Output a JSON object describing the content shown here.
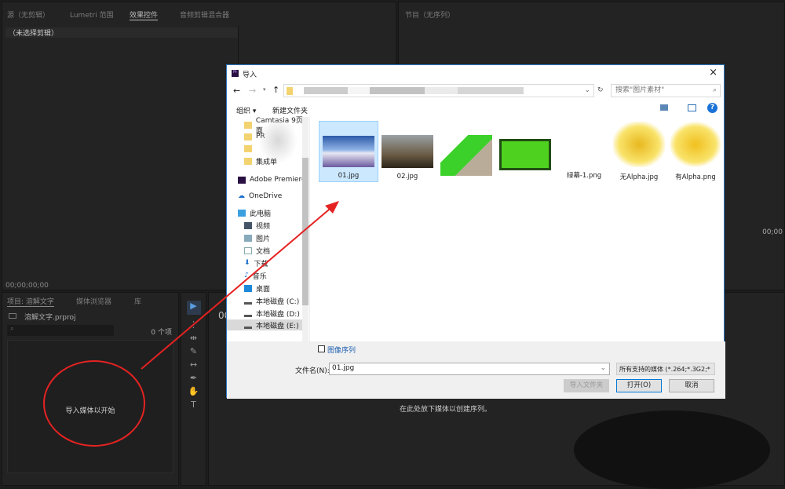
{
  "source_panel": {
    "tabs": [
      "源（无剪辑）",
      "Lumetri 范围",
      "效果控件",
      "音频剪辑混合器"
    ],
    "no_clip": "（未选择剪辑）",
    "timecode": "00;00;00;00"
  },
  "program_panel": {
    "title": "节目（无序列）",
    "timecode": "00;00"
  },
  "project_panel": {
    "tabs": [
      "项目: 溶解文字",
      "媒体浏览器",
      "库"
    ],
    "project_file": "溶解文字.prproj",
    "item_count": "0 个项",
    "empty_hint": "导入媒体以开始"
  },
  "timeline": {
    "timecode": "00",
    "drop_hint": "在此处放下媒体以创建序列。"
  },
  "dialog": {
    "title": "导入",
    "search_placeholder": "搜索\"图片素材\"",
    "organize": "组织 ▾",
    "new_folder": "新建文件夹",
    "nav": [
      "Camtasia 9页面",
      "PR",
      "",
      "集成单",
      "Adobe Premiere",
      "OneDrive",
      "此电脑",
      "视频",
      "图片",
      "文档",
      "下载",
      "音乐",
      "桌面",
      "本地磁盘 (C:)",
      "本地磁盘 (D:)",
      "本地磁盘 (E:)"
    ],
    "files": [
      {
        "name": "01.jpg",
        "selected": true
      },
      {
        "name": "02.jpg"
      },
      {
        "name": ""
      },
      {
        "name": ""
      },
      {
        "name": "绿幕-1.png"
      },
      {
        "name": "无Alpha.jpg"
      },
      {
        "name": "有Alpha.png"
      }
    ],
    "image_sequence": "图像序列",
    "filename_label": "文件名(N):",
    "filename_value": "01.jpg",
    "filter": "所有支持的媒体 (*.264;*.3G2;*",
    "import_folder": "导入文件夹",
    "open": "打开(O)",
    "cancel": "取消"
  }
}
